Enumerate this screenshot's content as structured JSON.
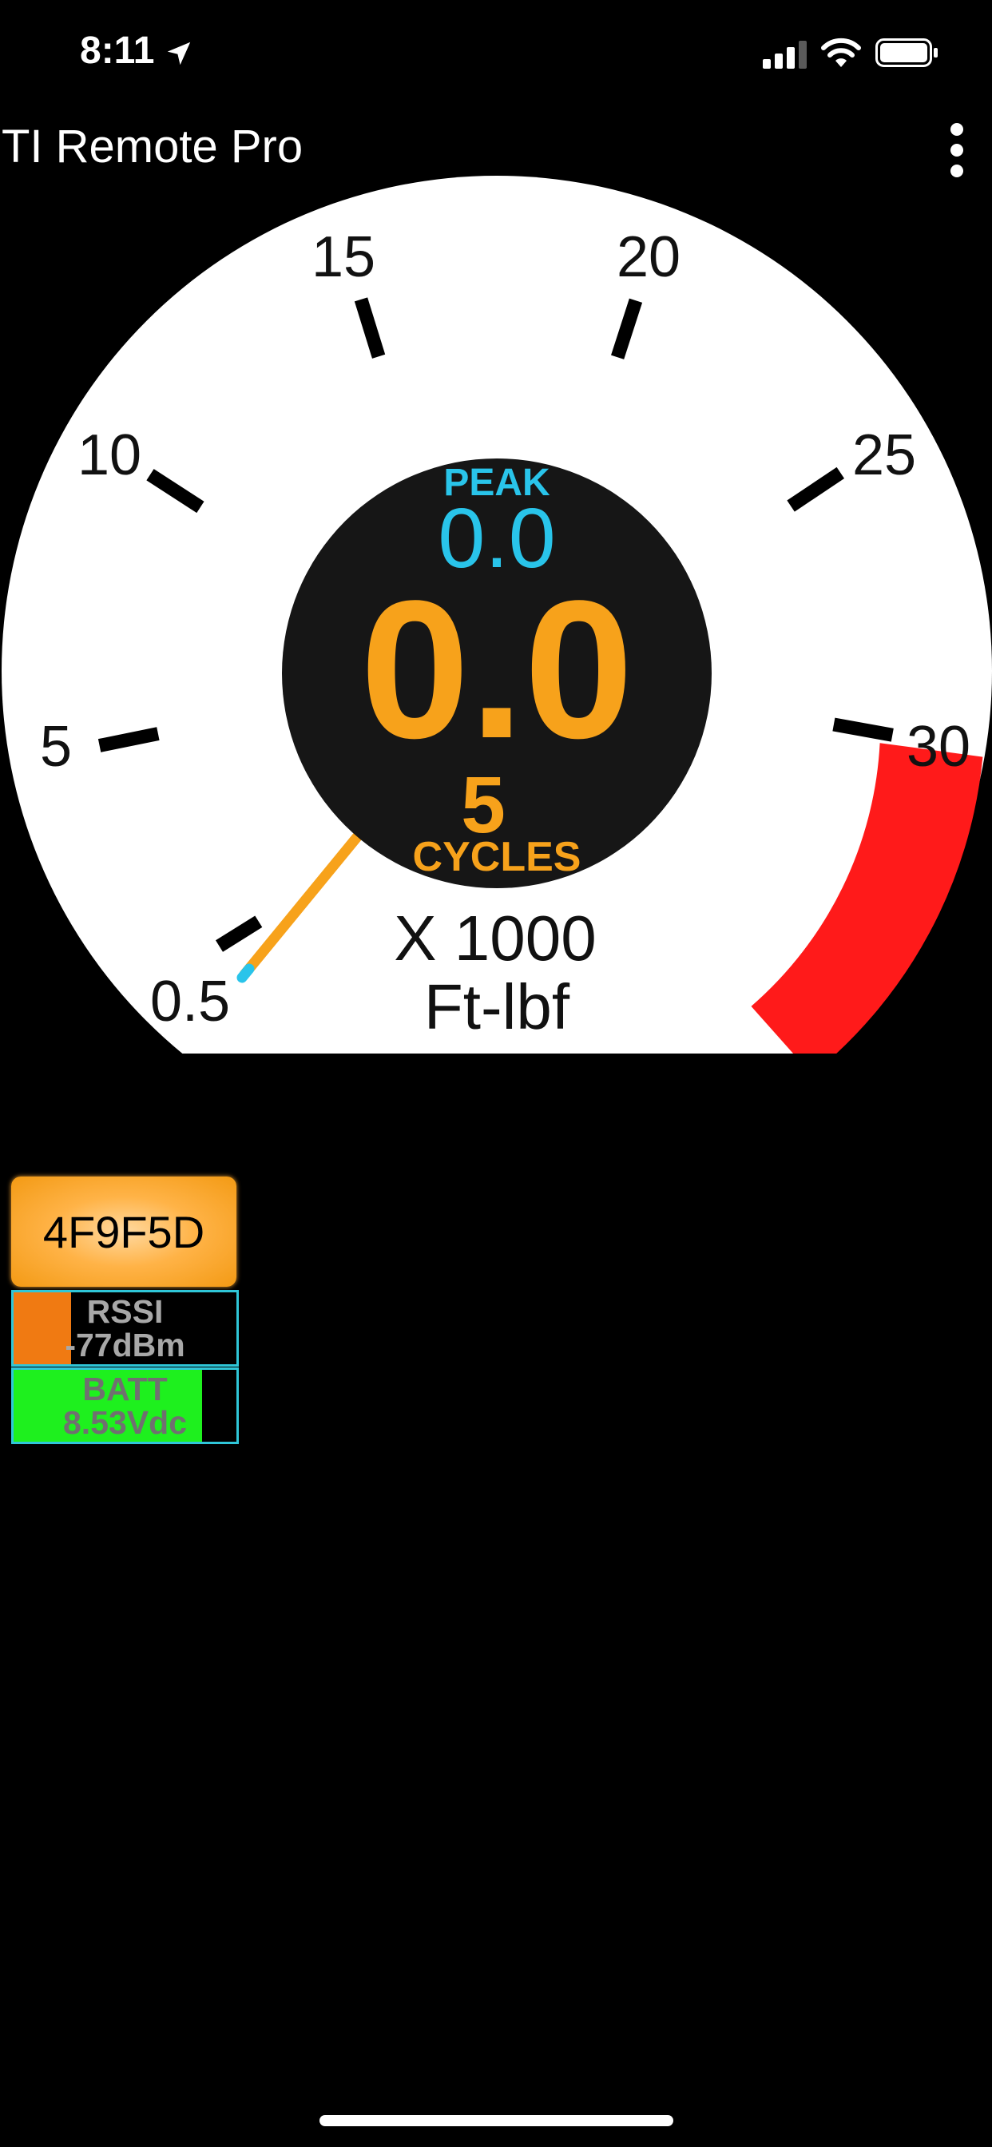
{
  "status_bar": {
    "time": "8:11"
  },
  "app": {
    "title": "TI Remote Pro"
  },
  "gauge": {
    "tick_labels": [
      "0.5",
      "5",
      "10",
      "15",
      "20",
      "25",
      "30"
    ],
    "peak_label": "PEAK",
    "peak_value": "0.0",
    "current_value": "0.0",
    "cycles_count": "5",
    "cycles_label": "CYCLES",
    "multiplier": "X 1000",
    "unit": "Ft-lbf",
    "needle_value": 0.5,
    "redzone_start": 30,
    "colors": {
      "dial": "#ffffff",
      "hub": "#161616",
      "peak": "#29c4ea",
      "value": "#f7a21b",
      "needle": "#f7a21b",
      "redzone": "#ff1a1a",
      "ticks": "#000000"
    }
  },
  "device": {
    "id": "4F9F5D"
  },
  "rssi": {
    "label": "RSSI",
    "value": "-77dBm",
    "fill_color": "#f07a12"
  },
  "battery": {
    "label": "BATT",
    "value": "8.53Vdc",
    "fill_color": "#1ef01e"
  }
}
